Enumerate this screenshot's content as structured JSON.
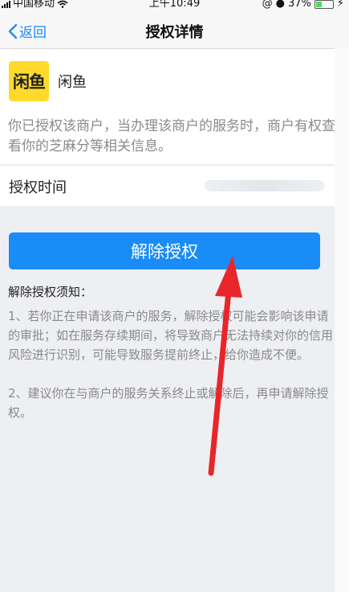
{
  "status_bar": {
    "carrier": "中国移动",
    "time": "上午10:49",
    "battery": "37%"
  },
  "nav": {
    "back_label": "返回",
    "title": "授权详情"
  },
  "merchant": {
    "logo_text": "闲鱼",
    "name": "闲鱼",
    "description": "你已授权该商户，当办理该商户的服务时，商户有权查看你的芝麻分等相关信息。"
  },
  "auth_time": {
    "label": "授权时间"
  },
  "revoke_button": {
    "label": "解除授权"
  },
  "notice": {
    "title": "解除授权须知：",
    "items": [
      "1、若你正在申请该商户的服务，解除授权可能会影响该申请的审批；如在服务存续期间，将导致商户无法持续对你的信用风险进行识别，可能导致服务提前终止，给你造成不便。",
      "2、建议你在与商户的服务关系终止或解除后，再申请解除授权。"
    ]
  },
  "colors": {
    "accent": "#1a8cf7",
    "logo_bg": "#ffda2b",
    "annotation_arrow": "#e8262a"
  }
}
